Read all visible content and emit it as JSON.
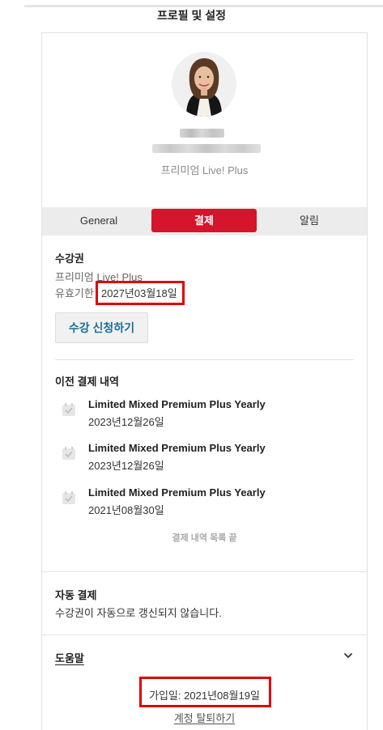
{
  "header": {
    "title": "프로필 및 설정"
  },
  "profile": {
    "plan": "프리미엄 Live! Plus"
  },
  "tabs": [
    {
      "label": "General",
      "active": false
    },
    {
      "label": "결제",
      "active": true
    },
    {
      "label": "알림",
      "active": false
    }
  ],
  "subscription": {
    "title": "수강권",
    "plan": "프리미엄 Live! Plus",
    "validity_label": "유효기한",
    "validity_date": "2027년03월18일",
    "enroll_button": "수강 신청하기"
  },
  "history": {
    "title": "이전 결제 내역",
    "items": [
      {
        "name": "Limited Mixed Premium Plus Yearly",
        "date": "2023년12월26일"
      },
      {
        "name": "Limited Mixed Premium Plus Yearly",
        "date": "2023년12월26일"
      },
      {
        "name": "Limited Mixed Premium Plus Yearly",
        "date": "2021년08월30일"
      }
    ],
    "end_text": "결제 내역 목록 끝"
  },
  "auto_payment": {
    "title": "자동 결제",
    "description": "수강권이 자동으로 갱신되지 않습니다."
  },
  "help": {
    "title": "도움말",
    "join_date": "가입일: 2021년08월19일",
    "withdraw_link": "계정 탈퇴하기"
  },
  "colors": {
    "accent": "#d4152b",
    "highlight": "#e00000",
    "button_text": "#1a6f9a"
  }
}
